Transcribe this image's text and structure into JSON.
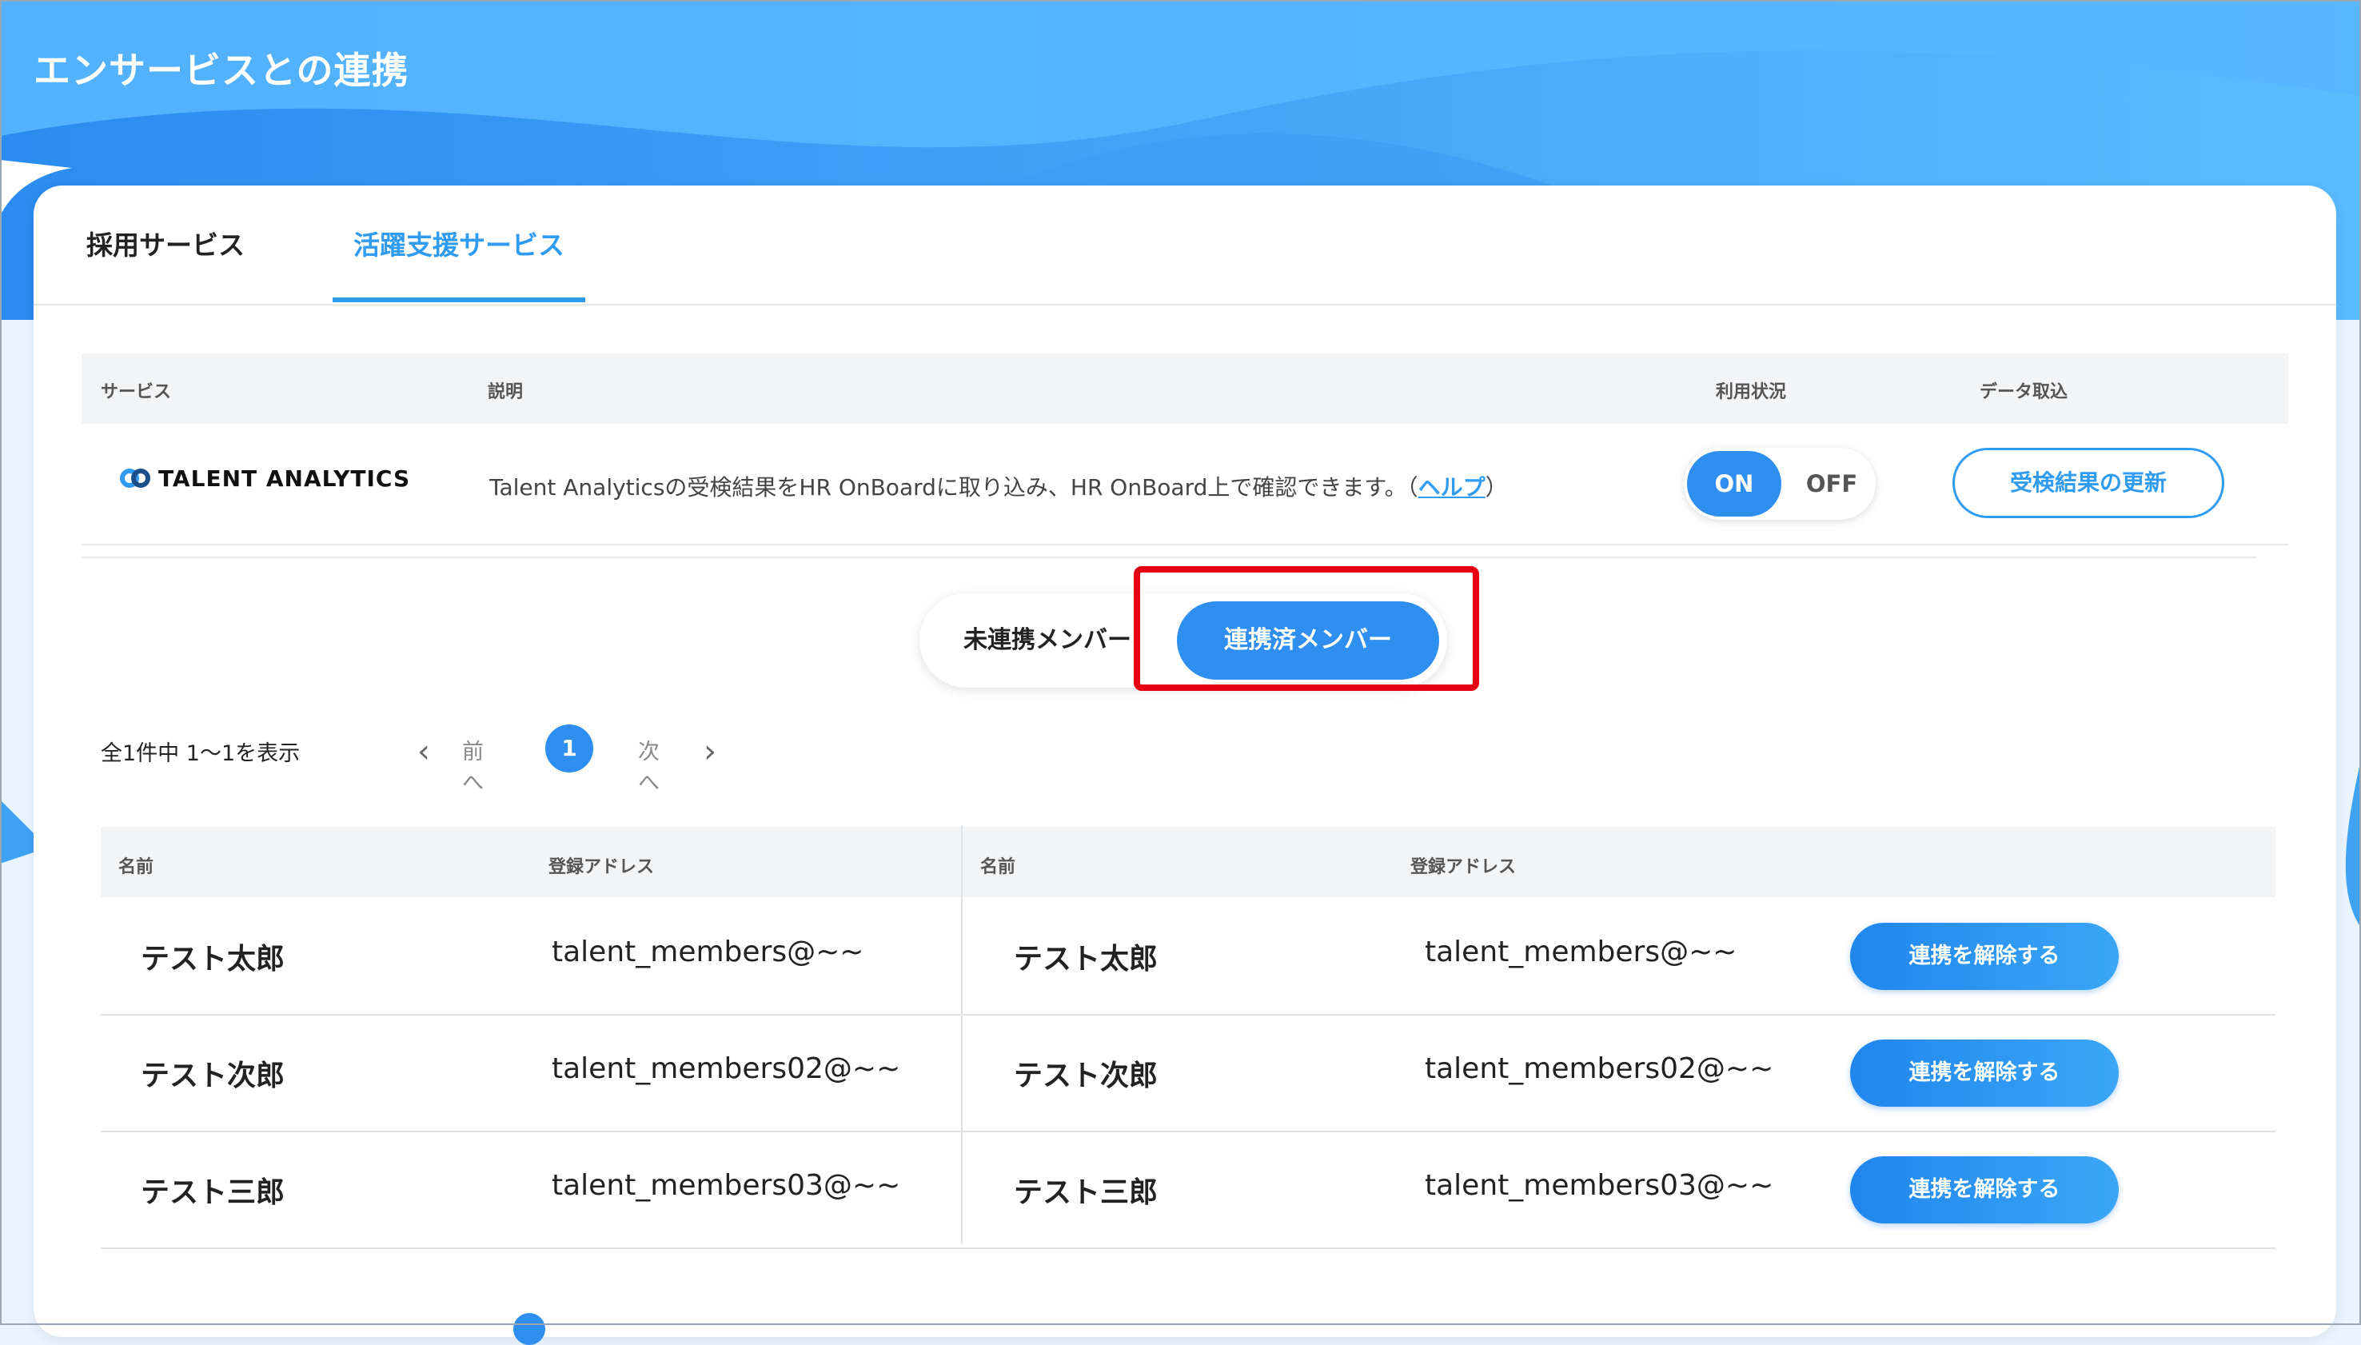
{
  "page_title": "エンサービスとの連携",
  "tabs": [
    {
      "label": "採用サービス"
    },
    {
      "label": "活躍支援サービス"
    }
  ],
  "service_table": {
    "headers": {
      "service": "サービス",
      "description": "説明",
      "status": "利用状況",
      "import": "データ取込"
    },
    "row": {
      "logo_text": "TALENT ANALYTICS",
      "description": "Talent Analyticsの受検結果をHR OnBoardに取り込み、HR OnBoard上で確認できます。（",
      "help_link": "ヘルプ",
      "description_end": "）",
      "toggle": {
        "on_label": "ON",
        "off_label": "OFF",
        "state": "ON"
      },
      "refresh_button": "受検結果の更新"
    }
  },
  "member_filter": {
    "unlinked": "未連携メンバー",
    "linked": "連携済メンバー",
    "selected": "連携済メンバー"
  },
  "pagination": {
    "summary": "全1件中 1〜1を表示",
    "prev": "前へ",
    "current": "1",
    "next": "次へ"
  },
  "member_table": {
    "headers": {
      "name": "名前",
      "address": "登録アドレス"
    },
    "unlink_label": "連携を解除する",
    "rows": [
      {
        "left_name": "テスト太郎",
        "left_address": "talent_members@~~",
        "right_name": "テスト太郎",
        "right_address": "talent_members@~~"
      },
      {
        "left_name": "テスト次郎",
        "left_address": "talent_members02@~~",
        "right_name": "テスト次郎",
        "right_address": "talent_members02@~~"
      },
      {
        "left_name": "テスト三郎",
        "left_address": "talent_members03@~~",
        "right_name": "テスト三郎",
        "right_address": "talent_members03@~~"
      }
    ]
  },
  "colors": {
    "accent": "#2e8ff0",
    "highlight": "#e60012",
    "hero_light": "#5bb8ff",
    "hero_dark": "#2f8ff0"
  }
}
